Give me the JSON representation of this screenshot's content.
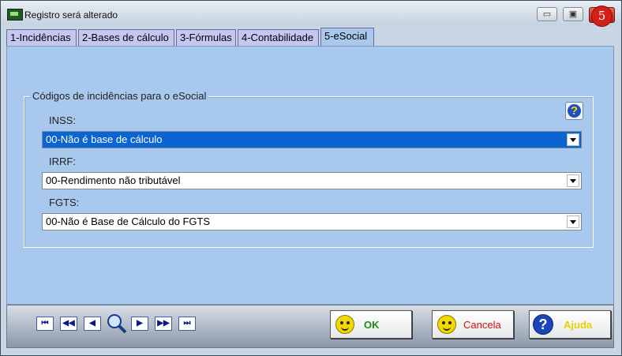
{
  "window": {
    "title": "Registro será alterado",
    "badge": "5",
    "controls": {
      "minimize": "▭",
      "restore": "▣"
    }
  },
  "tabs": [
    {
      "label": "1-Incidências"
    },
    {
      "label": "2-Bases de cálculo"
    },
    {
      "label": "3-Fórmulas"
    },
    {
      "label": "4-Contabilidade"
    },
    {
      "label": "5-eSocial",
      "active": true
    }
  ],
  "group": {
    "legend": "Códigos de incidências para o eSocial",
    "help_icon": "question-icon"
  },
  "fields": {
    "inss": {
      "label": "INSS:",
      "value": "00-Não é base de cálculo"
    },
    "irrf": {
      "label": "IRRF:",
      "value": "00-Rendimento não tributável"
    },
    "fgts": {
      "label": "FGTS:",
      "value": "00-Não é Base de Cálculo do FGTS"
    }
  },
  "navigation": {
    "first": "⏮",
    "prev_page": "◀◀",
    "prev": "◀",
    "search": "search-icon",
    "next": "▶",
    "next_page": "▶▶",
    "last": "⏭"
  },
  "buttons": {
    "ok": {
      "label": "OK",
      "color": "#1a8a1a"
    },
    "cancel": {
      "label": "Cancela",
      "color": "#d01010"
    },
    "help": {
      "label": "Ajuda",
      "color": "#e8d000"
    }
  },
  "colors": {
    "panel": "#a8c8ee",
    "selected_field": "#0a64d2"
  }
}
